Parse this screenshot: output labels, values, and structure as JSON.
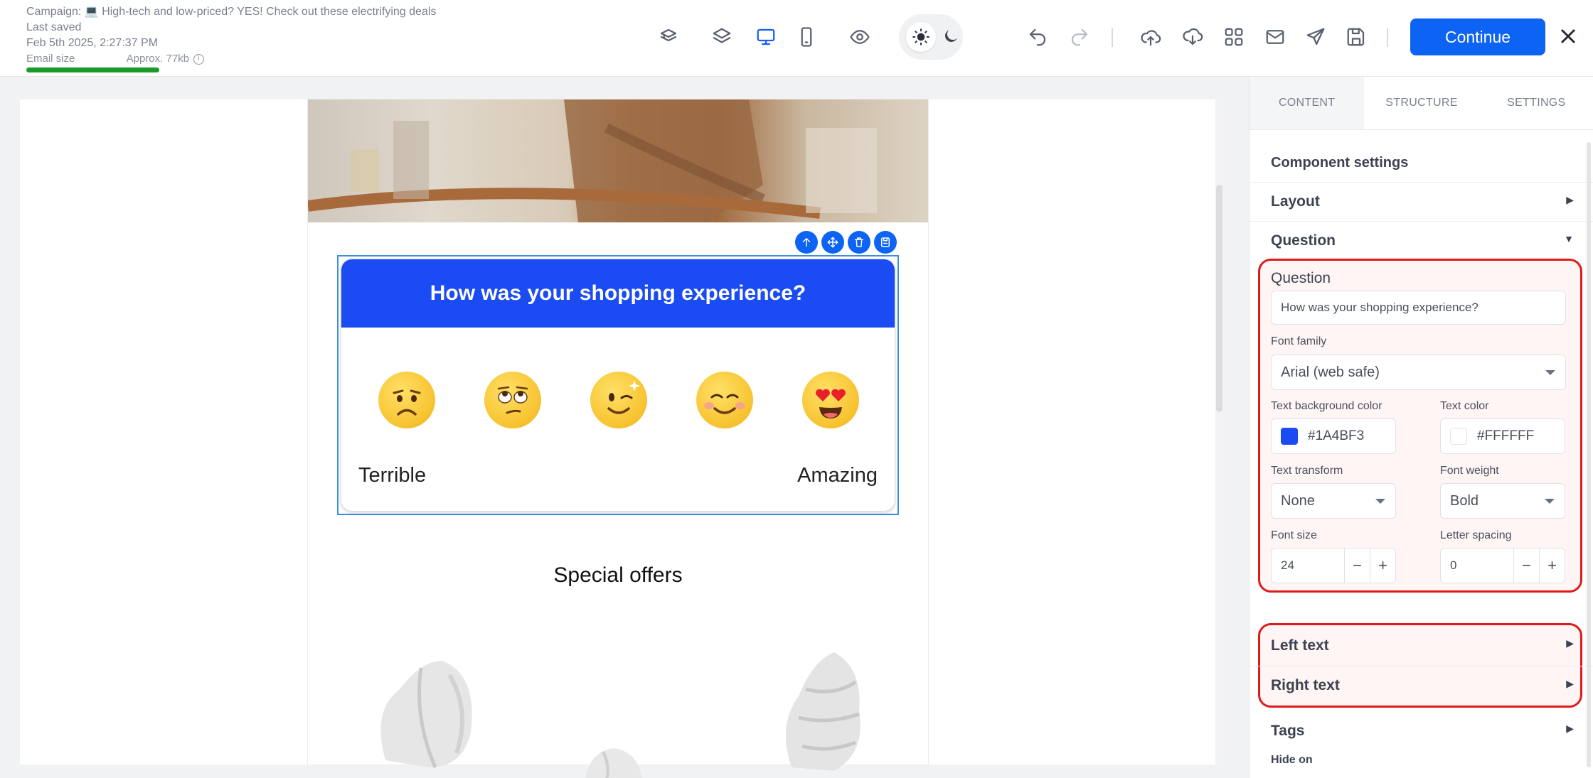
{
  "header": {
    "campaign": "Campaign: 💻 High-tech and low-priced? YES! Check out these electrifying deals",
    "last_saved_label": "Last saved",
    "last_saved_value": "Feb 5th 2025, 2:27:37 PM",
    "email_size_label": "Email size",
    "email_size_value": "Approx. 77kb",
    "continue_label": "Continue"
  },
  "toolbar_icons": [
    "stack-icon",
    "layers-icon",
    "desktop-icon",
    "mobile-icon",
    "preview-eye-icon",
    "sun-icon",
    "moon-icon",
    "undo-icon",
    "redo-icon",
    "upload-icon",
    "download-icon",
    "grid-icon",
    "mail-icon",
    "send-icon",
    "save-icon",
    "close-icon"
  ],
  "email": {
    "survey": {
      "question": "How was your shopping experience?",
      "left_label": "Terrible",
      "right_label": "Amazing",
      "emojis": [
        "worried-face",
        "rolling-eyes-face",
        "winking-face",
        "smiling-blush-face",
        "heart-eyes-face"
      ]
    },
    "special_offers": "Special offers"
  },
  "panel": {
    "tabs": [
      "CONTENT",
      "STRUCTURE",
      "SETTINGS"
    ],
    "section_title": "Component settings",
    "layout_label": "Layout",
    "question_section_label": "Question",
    "question_field_label": "Question",
    "question_value": "How was your shopping experience?",
    "font_family_label": "Font family",
    "font_family_value": "Arial (web safe)",
    "text_bg_label": "Text background color",
    "text_bg_value": "#1A4BF3",
    "text_color_label": "Text color",
    "text_color_value": "#FFFFFF",
    "text_transform_label": "Text transform",
    "text_transform_value": "None",
    "font_weight_label": "Font weight",
    "font_weight_value": "Bold",
    "font_size_label": "Font size",
    "font_size_value": "24",
    "letter_spacing_label": "Letter spacing",
    "letter_spacing_value": "0",
    "left_text_label": "Left text",
    "right_text_label": "Right text",
    "tags_label": "Tags",
    "hide_on_label": "Hide on"
  },
  "colors": {
    "accent": "#0D63F3",
    "survey_header": "#1A4BF3",
    "highlight": "#E01A1A",
    "size_bar": "#1A9A2A"
  }
}
